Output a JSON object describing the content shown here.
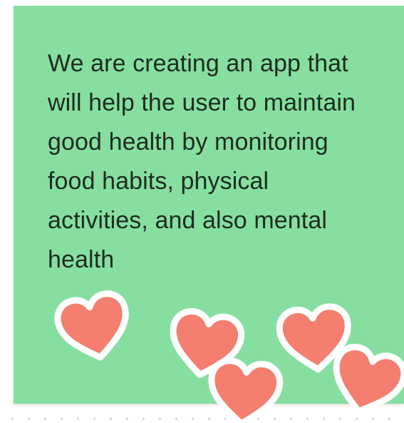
{
  "sticky_note": {
    "text": "We are creating an app that will help the user to maintain good health by monitoring food habits, physical activities, and also mental health",
    "background_color": "#86dfa0",
    "text_color": "#1d2b22"
  },
  "stickers": {
    "icon": "heart-icon",
    "fill_color": "#f47f70",
    "outline_color": "#ffffff",
    "count": 5
  }
}
